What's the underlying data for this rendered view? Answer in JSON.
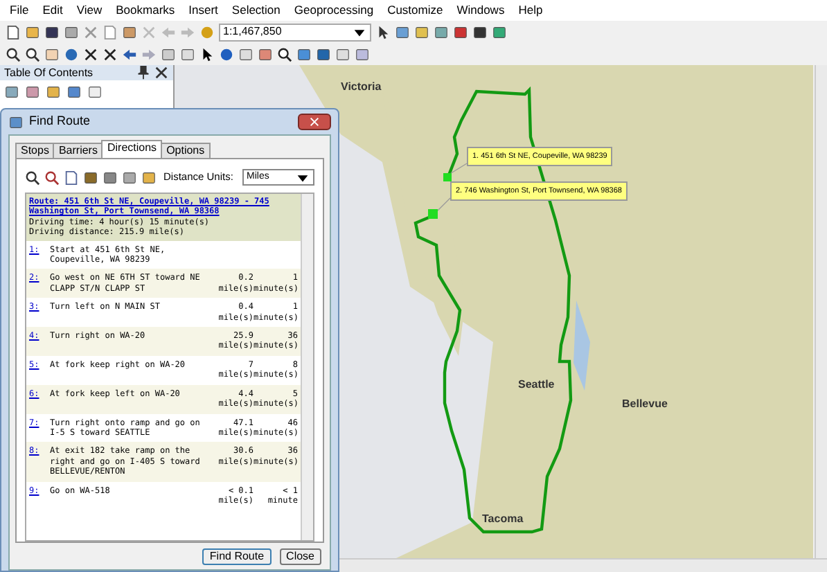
{
  "menu": [
    "File",
    "Edit",
    "View",
    "Bookmarks",
    "Insert",
    "Selection",
    "Geoprocessing",
    "Customize",
    "Windows",
    "Help"
  ],
  "toolbar": {
    "scale": "1:1,467,850"
  },
  "toc": {
    "title": "Table Of Contents"
  },
  "map": {
    "labels": [
      {
        "text": "Victoria",
        "kind": "city"
      },
      {
        "text": "Seattle",
        "kind": "city"
      },
      {
        "text": "Bellevue",
        "kind": "city"
      },
      {
        "text": "Tacoma",
        "kind": "city"
      }
    ],
    "callouts": [
      "1. 451 6th St NE, Coupeville, WA 98239",
      "2. 746 Washington St, Port Townsend, WA 98368"
    ]
  },
  "dialog": {
    "title": "Find Route",
    "tabs": [
      {
        "label": "Stops",
        "selected": false
      },
      {
        "label": "Barriers",
        "selected": false
      },
      {
        "label": "Directions",
        "selected": true
      },
      {
        "label": "Options",
        "selected": false
      }
    ],
    "units_label": "Distance Units:",
    "units": "Miles",
    "route": {
      "title": "Route: 451 6th St NE, Coupeville, WA 98239 - 745 Washington St, Port Townsend, WA 98368",
      "driving_time": "Driving time: 4 hour(s) 15 minute(s)",
      "driving_distance": "Driving distance: 215.9 mile(s)"
    },
    "steps": [
      {
        "number": "1:",
        "text": "Start at 451 6th St NE, Coupeville, WA 98239"
      },
      {
        "number": "2:",
        "text": "Go west on NE 6TH ST toward NE CLAPP ST/N CLAPP ST",
        "distance": "0.2 mile(s)",
        "time": "1 minute(s)"
      },
      {
        "number": "3:",
        "text": "Turn left on N MAIN ST",
        "distance": "0.4 mile(s)",
        "time": "1 minute(s)"
      },
      {
        "number": "4:",
        "text": "Turn right on WA-20",
        "distance": "25.9 mile(s)",
        "time": "36 minute(s)"
      },
      {
        "number": "5:",
        "text": "At fork keep right on WA-20",
        "distance": "7 mile(s)",
        "time": "8 minute(s)"
      },
      {
        "number": "6:",
        "text": "At fork keep left on WA-20",
        "distance": "4.4 mile(s)",
        "time": "5 minute(s)"
      },
      {
        "number": "7:",
        "text": "Turn right onto ramp and go on I-5 S toward SEATTLE",
        "distance": "47.1 mile(s)",
        "time": "46 minute(s)"
      },
      {
        "number": "8:",
        "text": "At exit 182 take ramp on the right and go on I-405 S toward BELLEVUE/RENTON",
        "distance": "30.6 mile(s)",
        "time": "36 minute(s)"
      },
      {
        "number": "9:",
        "text": "Go on WA-518",
        "distance": "< 0.1 mile(s)",
        "time": "< 1 minute"
      }
    ],
    "buttons": [
      "Find Route",
      "Close"
    ]
  }
}
